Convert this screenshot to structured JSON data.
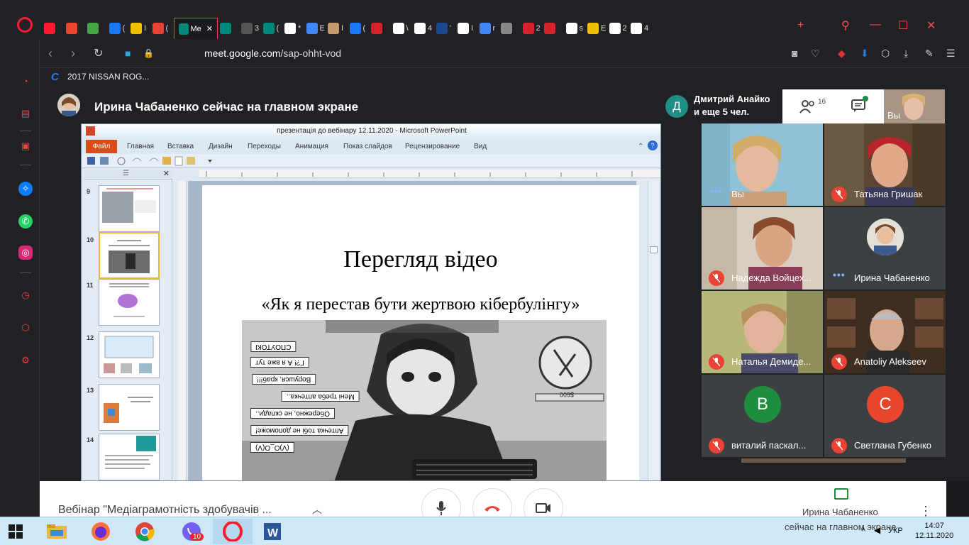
{
  "browser": {
    "url_host": "meet.google.com",
    "url_path": "/sap-ohht-vod",
    "bookmark_label": "2017 NISSAN ROG...",
    "tabs": [
      {
        "label": "",
        "color": "#ff1b2d"
      },
      {
        "label": "",
        "color": "#e8472c"
      },
      {
        "label": "",
        "color": "#47a447"
      },
      {
        "label": "(",
        "color": "#1877f2"
      },
      {
        "label": "I",
        "color": "#f0c000"
      },
      {
        "label": "(",
        "color": "#ea4335"
      },
      {
        "label": "Me",
        "color": "#00897b"
      },
      {
        "label": "",
        "color": "#00897b"
      },
      {
        "label": "3",
        "color": "#555"
      },
      {
        "label": "(",
        "color": "#00897b"
      },
      {
        "label": "*",
        "color": "#fff"
      },
      {
        "label": "E",
        "color": "#4285f4"
      },
      {
        "label": "I",
        "color": "#c49a6c"
      },
      {
        "label": "(",
        "color": "#1877f2"
      },
      {
        "label": "",
        "color": "#d6222a"
      },
      {
        "label": "\\",
        "color": "#fff"
      },
      {
        "label": "4",
        "color": "#fff"
      },
      {
        "label": "'",
        "color": "#1b4a8f"
      },
      {
        "label": "I",
        "color": "#fff"
      },
      {
        "label": "r",
        "color": "#4285f4"
      },
      {
        "label": "",
        "color": "#888"
      },
      {
        "label": "2",
        "color": "#d6222a"
      },
      {
        "label": "",
        "color": "#d6222a"
      },
      {
        "label": "s",
        "color": "#fff"
      },
      {
        "label": "E",
        "color": "#f0c000"
      },
      {
        "label": "2",
        "color": "#fff"
      },
      {
        "label": "4",
        "color": "#fff"
      }
    ]
  },
  "meet": {
    "presenter_banner": "Ирина Чабаненко сейчас на главном экране",
    "join_avatar_letter": "Д",
    "join_name": "Дмитрий Анайко",
    "join_more": "и еще 5 чел.",
    "people_count": "16",
    "self_label": "Вы",
    "meeting_title": "Вебінар \"Медіаграмотність здобувачів ...",
    "present_name": "Ирина Чабаненко",
    "present_sub": "сейчас на главном экране",
    "participants": [
      {
        "name": "Вы",
        "muted": false
      },
      {
        "name": "Татьяна Гришак",
        "muted": true
      },
      {
        "name": "Надежда Войцех...",
        "muted": true
      },
      {
        "name": "Ирина Чабаненко",
        "muted": false
      },
      {
        "name": "Наталья Демиде...",
        "muted": true
      },
      {
        "name": "Anatoliy Alekseev",
        "muted": true
      },
      {
        "name": "виталий паскал...",
        "muted": true,
        "letter": "В",
        "color": "#1e8e3e"
      },
      {
        "name": "Светлана Губенко",
        "muted": true,
        "letter": "С",
        "color": "#e8452c"
      }
    ]
  },
  "ppt": {
    "title": "презентація до вебінару 12.11.2020  -  Microsoft PowerPoint",
    "file_tab": "Файл",
    "ribbon_tabs": [
      "Главная",
      "Вставка",
      "Дизайн",
      "Переходы",
      "Анимация",
      "Показ слайдов",
      "Рецензирование",
      "Вид"
    ],
    "slide_numbers": [
      "9",
      "10",
      "11",
      "12",
      "13",
      "14"
    ],
    "slide_title": "Перегляд відео",
    "slide_subtitle": "«Як я перестав  бути жертвою кібербулінгу»",
    "comic_bubbles": [
      "СПОУТОКІ",
      "Г?! А я вже тут",
      "Ворушся, краб!!!",
      "Мені треба аптечка..",
      "Обережно, не склади..",
      "Аптечка тобі не допоможе!",
      "(V)O_O(V)"
    ],
    "price_tag": "$600"
  },
  "taskbar": {
    "time": "14:07",
    "date": "12.11.2020",
    "lang": "УКР",
    "viber_badge": "10"
  }
}
